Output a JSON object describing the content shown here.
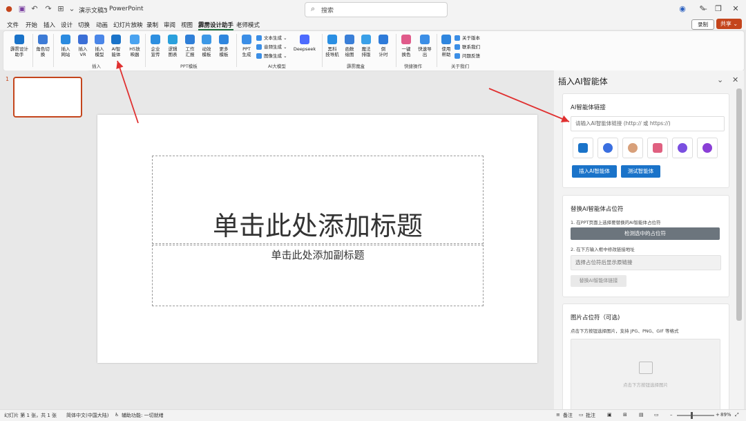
{
  "titlebar": {
    "doc_title": "演示文稿3",
    "separator": "-",
    "app_name": "PowerPoint",
    "search_placeholder": "搜索"
  },
  "menubar": {
    "tabs": [
      "文件",
      "开始",
      "插入",
      "设计",
      "切换",
      "动画",
      "幻灯片放映",
      "录制",
      "审阅",
      "视图",
      "霹雳设计助手",
      "老师模式"
    ],
    "active_tab": "霹雳设计助手",
    "record_label": "录制",
    "share_label": "共享"
  },
  "ribbon": {
    "buttons": [
      {
        "label": "霹雳设计\n助手",
        "icon": "assistant-icon",
        "color": "#1a73c9"
      },
      {
        "label": "角色切\n换",
        "icon": "role-switch-icon",
        "color": "#3d7bd6"
      },
      {
        "label": "插入\n网站",
        "icon": "web-icon",
        "color": "#2b8be0"
      },
      {
        "label": "插入\nVR",
        "icon": "vr-icon",
        "color": "#3b6fd6"
      },
      {
        "label": "插入\n模型",
        "icon": "model-icon",
        "color": "#4a86e8"
      },
      {
        "label": "AI智\n能体",
        "icon": "ai-agent-icon",
        "color": "#1a73c9"
      },
      {
        "label": "H5放\n映器",
        "icon": "h5-player-icon",
        "color": "#4aa3f0"
      },
      {
        "label": "企业\n宣传",
        "icon": "enterprise-icon",
        "color": "#2d8fe0"
      },
      {
        "label": "逻辑\n图表",
        "icon": "logic-chart-icon",
        "color": "#2aa0dc"
      },
      {
        "label": "工作\n汇报",
        "icon": "report-icon",
        "color": "#2f7fd8"
      },
      {
        "label": "动效\n模板",
        "icon": "motion-template-icon",
        "color": "#3c98e6"
      },
      {
        "label": "更多\n模板",
        "icon": "more-templates-icon",
        "color": "#2f86de"
      },
      {
        "label": "PPT\n生成",
        "icon": "ppt-generate-icon",
        "color": "#3b8ee6"
      },
      {
        "label": "Deepseek",
        "icon": "deepseek-icon",
        "color": "#4d6bfe"
      },
      {
        "label": "黑科\n技导航",
        "icon": "navigation-icon",
        "color": "#2a8fe3"
      },
      {
        "label": "函数\n绘图",
        "icon": "function-plot-icon",
        "color": "#3a7fd8"
      },
      {
        "label": "魔法\n排版",
        "icon": "magic-layout-icon",
        "color": "#3aa0e8"
      },
      {
        "label": "倒\n计时",
        "icon": "countdown-icon",
        "color": "#2e7bd9"
      },
      {
        "label": "一键\n换色",
        "icon": "recolor-icon",
        "color": "#e05a8a"
      },
      {
        "label": "快速导\n出",
        "icon": "export-icon",
        "color": "#3b8ee6"
      },
      {
        "label": "使用\n帮助",
        "icon": "help-icon",
        "color": "#2f86de"
      }
    ],
    "small_items": [
      {
        "label": "文本生成",
        "icon": "text-gen-icon",
        "color": "#3b8ee6"
      },
      {
        "label": "音频生成",
        "icon": "audio-gen-icon",
        "color": "#3b8ee6"
      },
      {
        "label": "图像生成",
        "icon": "image-gen-icon",
        "color": "#3b8ee6"
      },
      {
        "label": "关于版本",
        "icon": "version-icon",
        "color": "#3b8ee6"
      },
      {
        "label": "联系我们",
        "icon": "contact-icon",
        "color": "#3b8ee6"
      },
      {
        "label": "问题反馈",
        "icon": "feedback-icon",
        "color": "#3b8ee6"
      }
    ],
    "groups": [
      "插入",
      "PPT模板",
      "AI大模型",
      "霹雳魔盒",
      "快捷操作",
      "关于我们"
    ]
  },
  "slides": {
    "selected_number": "1"
  },
  "slide": {
    "title_placeholder": "单击此处添加标题",
    "subtitle_placeholder": "单击此处添加副标题"
  },
  "pane": {
    "title": "插入AI智能体",
    "link_card": {
      "heading": "AI智能体链接",
      "input_placeholder": "请输入AI智能体链接 (http:// 或 https://)",
      "agent_colors": [
        "#1a73c9",
        "#3a6fe0",
        "#d8a07a",
        "#e06080",
        "#7a4fe0",
        "#8a3fd6"
      ],
      "insert_button": "插入AI智能体",
      "test_button": "测试智能体"
    },
    "replace_card": {
      "heading": "替换AI智能体占位符",
      "step1": "1. 在PPT页面上选择要替换的AI智能体占位符",
      "detect_button": "检测选中的占位符",
      "step2": "2. 在下方输入框中修改链接地址",
      "field_placeholder": "选择占位符后显示原链接",
      "replace_button": "替换AI智能体链接"
    },
    "image_card": {
      "heading": "图片占位符（可选)",
      "hint": "点击下方按钮选择图片，支持 JPG、PNG、GIF 等格式",
      "upload_text": "点击下方按钮选择图片"
    }
  },
  "status": {
    "slide_count": "幻灯片 第 1 张，共 1 张",
    "language": "简体中文(中国大陆)",
    "accessibility": "辅助功能: 一切就绪",
    "notes": "备注",
    "comments": "批注",
    "zoom": "89%"
  }
}
